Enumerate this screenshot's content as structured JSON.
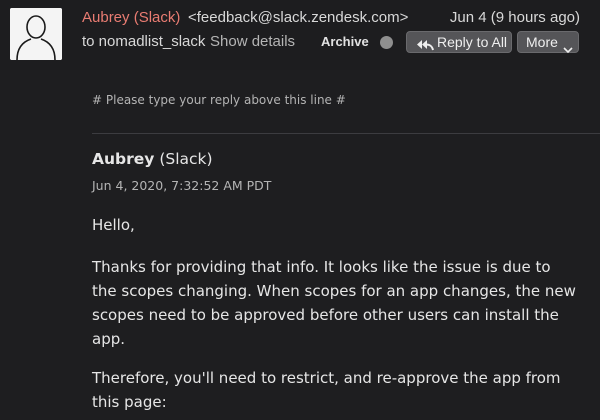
{
  "header": {
    "sender_name": "Aubrey (Slack)",
    "sender_email": "<feedback@slack.zendesk.com>",
    "date": "Jun 4 (9 hours ago)",
    "to_line": "to nomadlist_slack",
    "show_details": "Show details",
    "archive_label": "Archive",
    "reply_all_label": "Reply to All",
    "more_label": "More",
    "icons": [
      "avatar-placeholder-icon",
      "reply-all-icon",
      "chevron-down-icon"
    ],
    "colors": {
      "sender_name": "#e97c72",
      "button_bg": "#555558",
      "background": "#1e1e20"
    }
  },
  "email": {
    "reply_marker": "# Please type your reply above this line #",
    "author_name": "Aubrey",
    "author_suffix": " (Slack)",
    "timestamp": "Jun 4, 2020, 7:32:52 AM PDT",
    "paragraphs": [
      [
        "Hello,"
      ],
      [
        "Thanks for providing that info. It looks like the issue is due to",
        "the scopes changing. When scopes for an app changes, the new",
        "scopes need to be approved before other users can install the",
        "app."
      ],
      [
        "Therefore, you'll need to restrict, and re-approve the app from",
        "this page:"
      ]
    ]
  }
}
